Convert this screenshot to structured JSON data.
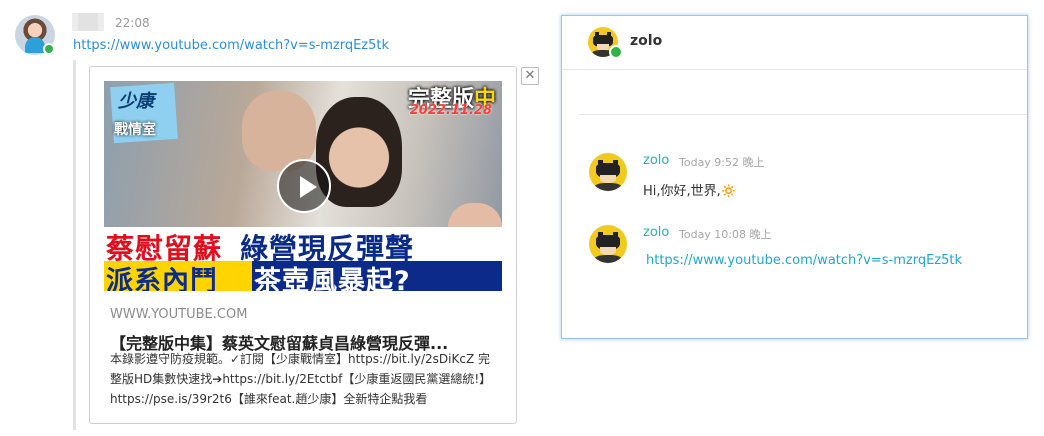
{
  "left_message": {
    "time": "22:08",
    "link": "https://www.youtube.com/watch?v=s-mzrqEz5tk",
    "embed": {
      "site": "WWW.YOUTUBE.COM",
      "title": "【完整版中集】蔡英文慰留蘇貞昌綠營現反彈...",
      "description": "本錄影遵守防疫規範。✓訂閱【少康戰情室】https://bit.ly/2sDiKcZ 完整版HD集數快速找➔https://bit.ly/2Etctbf【少康重返國民黨選總統!】https://pse.is/39r2t6【誰來feat.趙少康】全新特企點我看",
      "thumbnail": {
        "logo": "少康",
        "room": "戰情室",
        "version_prefix": "完整版",
        "version_suffix": "中",
        "date": "2022.11.28",
        "headline_red": "蔡慰留蘇",
        "headline_blue": "綠營現反彈聲",
        "subline_yellow": "派系內鬥",
        "subline_white": "茶壺風暴起?"
      },
      "close_glyph": "✕"
    }
  },
  "chat_panel": {
    "header_name": "zolo",
    "messages": [
      {
        "author": "zolo",
        "time": "Today 9:52 晚上",
        "text": "Hi,你好,世界,🔅"
      },
      {
        "author": "zolo",
        "time": "Today 10:08 晚上",
        "link": "https://www.youtube.com/watch?v=s-mzrqEz5tk"
      }
    ]
  },
  "colors": {
    "link_blue": "#2b8ed8",
    "author_teal": "#2fb0a8",
    "online_green": "#2fb34a",
    "panel_border": "#9ec3ea"
  },
  "icons": {
    "play": "play-icon",
    "close": "close-icon",
    "avatar": "batman-avatar"
  }
}
